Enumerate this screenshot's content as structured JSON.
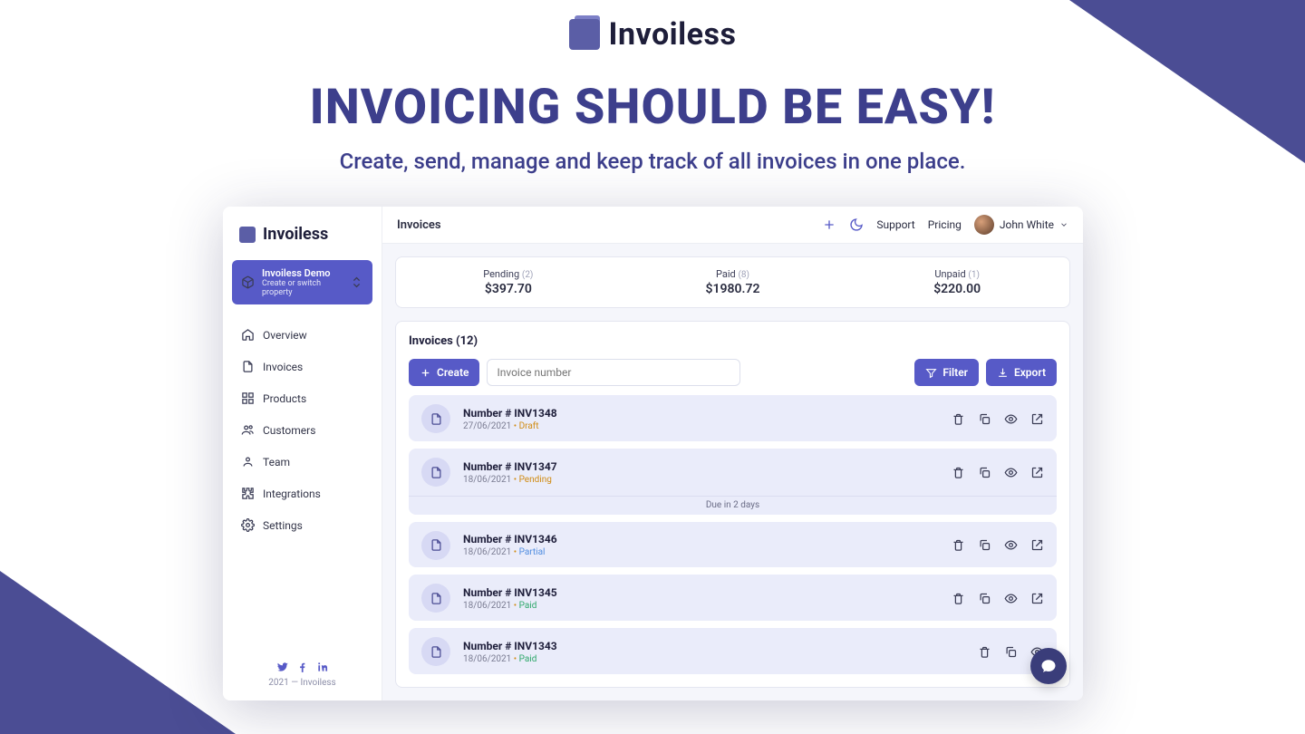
{
  "hero": {
    "brand": "Invoiless",
    "title": "INVOICING SHOULD BE EASY!",
    "subtitle": "Create, send, manage and keep track of all invoices in one place."
  },
  "app": {
    "brand": "Invoiless",
    "property": {
      "title": "Invoiless Demo",
      "subtitle": "Create or switch property"
    },
    "nav": [
      {
        "label": "Overview"
      },
      {
        "label": "Invoices"
      },
      {
        "label": "Products"
      },
      {
        "label": "Customers"
      },
      {
        "label": "Team"
      },
      {
        "label": "Integrations"
      },
      {
        "label": "Settings"
      }
    ],
    "footer": {
      "copyright": "2021 — Invoiless"
    },
    "topbar": {
      "title": "Invoices",
      "support": "Support",
      "pricing": "Pricing",
      "user": "John White"
    },
    "stats": [
      {
        "label": "Pending",
        "count": "(2)",
        "value": "$397.70"
      },
      {
        "label": "Paid",
        "count": "(8)",
        "value": "$1980.72"
      },
      {
        "label": "Unpaid",
        "count": "(1)",
        "value": "$220.00"
      }
    ],
    "list": {
      "heading": "Invoices (12)",
      "create": "Create",
      "filter": "Filter",
      "export": "Export",
      "search_placeholder": "Invoice number",
      "rows": [
        {
          "title": "Number # INV1348",
          "date": "27/06/2021",
          "status": "Draft",
          "status_class": "status-draft",
          "due": ""
        },
        {
          "title": "Number # INV1347",
          "date": "18/06/2021",
          "status": "Pending",
          "status_class": "status-pending",
          "due": "Due in 2 days"
        },
        {
          "title": "Number # INV1346",
          "date": "18/06/2021",
          "status": "Partial",
          "status_class": "status-partial",
          "due": ""
        },
        {
          "title": "Number # INV1345",
          "date": "18/06/2021",
          "status": "Paid",
          "status_class": "status-paid",
          "due": ""
        },
        {
          "title": "Number # INV1343",
          "date": "18/06/2021",
          "status": "Paid",
          "status_class": "status-paid",
          "due": ""
        }
      ]
    }
  }
}
